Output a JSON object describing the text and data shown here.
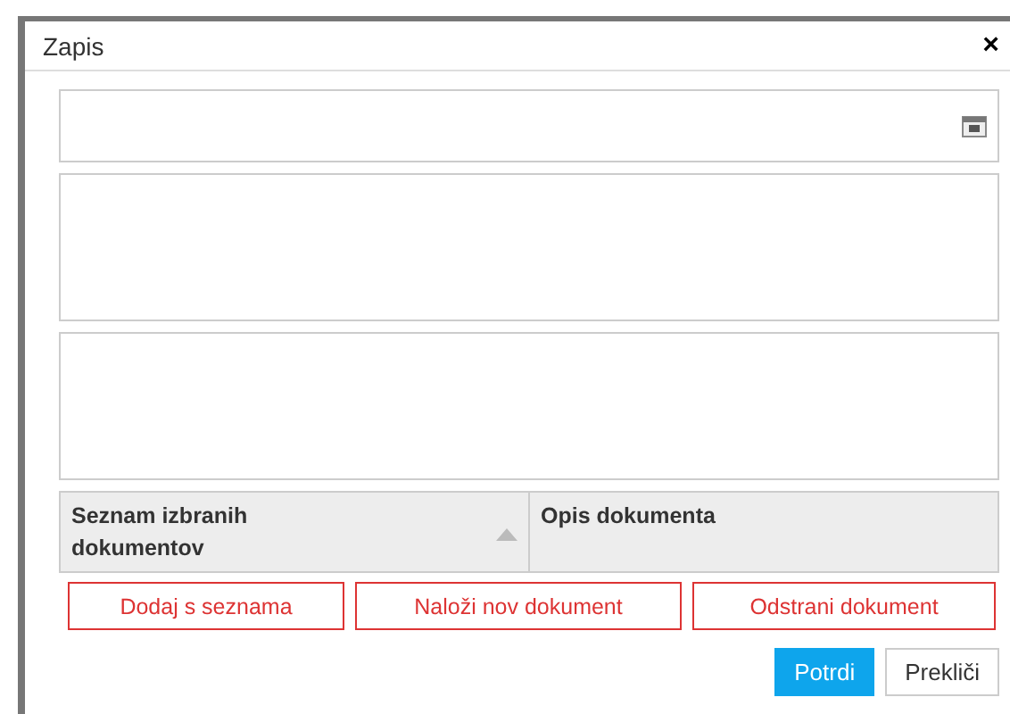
{
  "dialog": {
    "title": "Zapis",
    "close": "×"
  },
  "fields": [
    {
      "kind": "date"
    },
    {
      "kind": "textarea"
    },
    {
      "kind": "textarea"
    }
  ],
  "table": {
    "columns": [
      {
        "label": "Seznam izbranih dokumentov",
        "sorted": true
      },
      {
        "label": "Opis dokumenta",
        "sorted": false
      }
    ]
  },
  "actions": [
    "Dodaj s seznama",
    "Naloži nov dokument",
    "Odstrani dokument"
  ],
  "buttons": [
    {
      "label": "Potrdi",
      "kind": "primary"
    },
    {
      "label": "Prekliči",
      "kind": "secondary"
    }
  ]
}
